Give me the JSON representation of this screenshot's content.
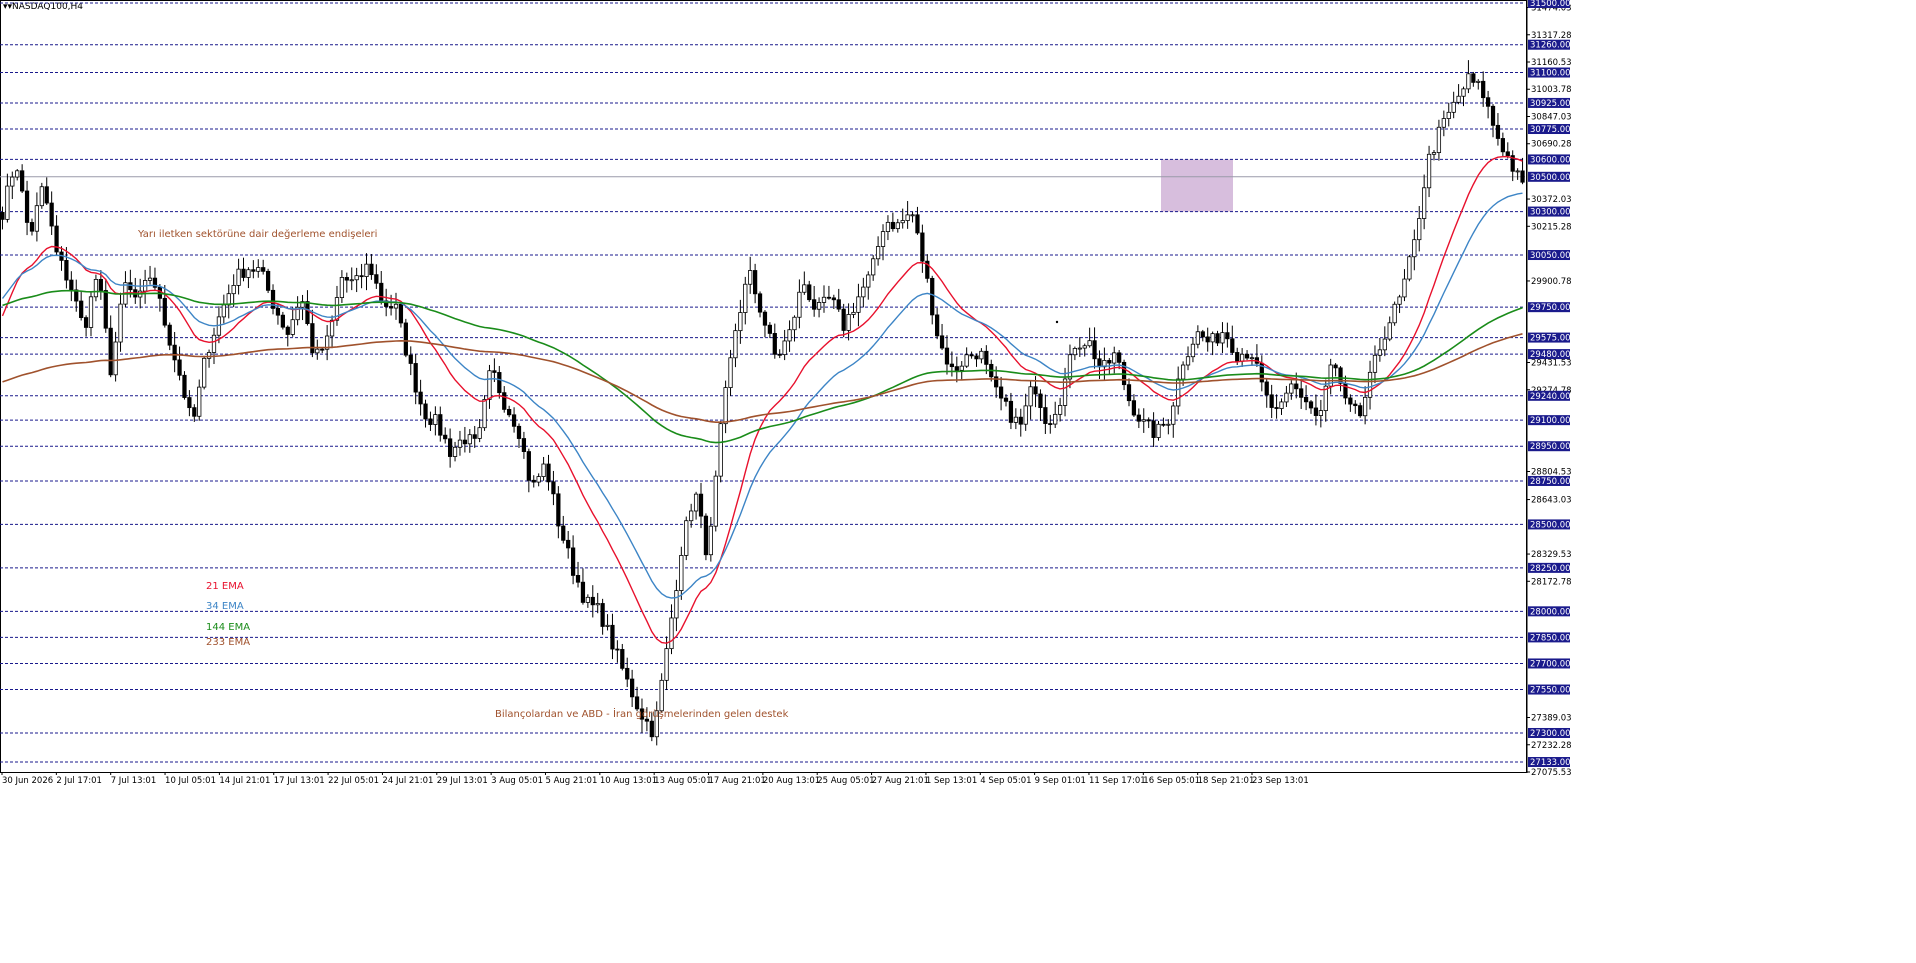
{
  "header": {
    "symbol": "NASDAQ100,H4"
  },
  "colors": {
    "hline": "#1a1a8c",
    "current": "#9a9aaa",
    "candle": "#000000",
    "axis_badge": "#1a1a8c",
    "zone": "#c9a8d2",
    "ema21": "#e8112d",
    "ema34": "#3d85c6",
    "ema144": "#1a8c1a",
    "ema233": "#a0522d",
    "annotation": "#a0522d"
  },
  "chart_data": {
    "type": "candlestick",
    "symbol": "NASDAQ100",
    "timeframe": "H4",
    "ylim": [
      27075.53,
      31500.0
    ],
    "current_price": "30500.00",
    "badge_levels": [
      "31500.00",
      "31260.00",
      "31100.00",
      "30925.00",
      "30775.00",
      "30600.00",
      "30500.00",
      "30300.00",
      "30050.00",
      "29750.00",
      "29575.00",
      "29480.00",
      "29240.00",
      "29100.00",
      "28950.00",
      "28750.00",
      "28500.00",
      "28250.00",
      "28000.00",
      "27850.00",
      "27700.00",
      "27550.00",
      "27300.00",
      "27133.00"
    ],
    "axis_ticks": [
      "31474.03",
      "31317.28",
      "31160.53",
      "31003.78",
      "30847.03",
      "30690.28",
      "30372.03",
      "30215.28",
      "29900.78",
      "29431.53",
      "29274.78",
      "28804.53",
      "28643.03",
      "28329.53",
      "28172.78",
      "27389.03",
      "27232.28",
      "27075.53"
    ],
    "x_labels": [
      "30 Jun 2026",
      "2 Jul 17:01",
      "7 Jul 13:01",
      "10 Jul 05:01",
      "14 Jul 21:01",
      "17 Jul 13:01",
      "22 Jul 05:01",
      "24 Jul 21:01",
      "29 Jul 13:01",
      "3 Aug 05:01",
      "5 Aug 21:01",
      "10 Aug 13:01",
      "13 Aug 05:01",
      "17 Aug 21:01",
      "20 Aug 13:01",
      "25 Aug 05:01",
      "27 Aug 21:01",
      "1 Sep 13:01",
      "4 Sep 05:01",
      "9 Sep 01:01",
      "11 Sep 17:01",
      "16 Sep 05:01",
      "18 Sep 21:01",
      "23 Sep 13:01"
    ],
    "close_path": [
      30300,
      30600,
      30150,
      30450,
      30050,
      29880,
      29620,
      29950,
      29380,
      29880,
      29780,
      29950,
      29650,
      29380,
      29060,
      29480,
      29700,
      29900,
      29980,
      29960,
      29760,
      29600,
      29820,
      29450,
      29560,
      29920,
      29880,
      30000,
      29780,
      29740,
      29420,
      29150,
      29080,
      28920,
      29000,
      28950,
      29400,
      29200,
      29060,
      28700,
      28850,
      28500,
      28250,
      28050,
      28000,
      27800,
      27600,
      27420,
      27300,
      27800,
      28350,
      28700,
      28300,
      29100,
      29620,
      29950,
      29700,
      29450,
      29600,
      29900,
      29720,
      29800,
      29640,
      29800,
      29940,
      30250,
      30220,
      30300,
      29950,
      29550,
      29380,
      29460,
      29500,
      29280,
      29160,
      29060,
      29320,
      29080,
      29240,
      29540,
      29560,
      29380,
      29480,
      29220,
      29080,
      29020,
      29120,
      29450,
      29600,
      29540,
      29620,
      29480,
      29500,
      29240,
      29120,
      29300,
      29220,
      29100,
      29450,
      29180,
      29120,
      29400,
      29640,
      29800,
      30100,
      30580,
      30780,
      30920,
      31060,
      31000,
      30760,
      30600,
      30440
    ],
    "zone": {
      "x0": "18 Sep 21:01",
      "x1": "23 Sep 13:01",
      "y0": 30300,
      "y1": 30600
    },
    "ema_labels": [
      "21 EMA",
      "34 EMA",
      "144 EMA",
      "233 EMA"
    ],
    "annotations": [
      "Yarı iletken sektörüne dair değerleme endişeleri",
      "Bilançolardan ve ABD - İran görüşmelerinden gelen destek"
    ]
  }
}
